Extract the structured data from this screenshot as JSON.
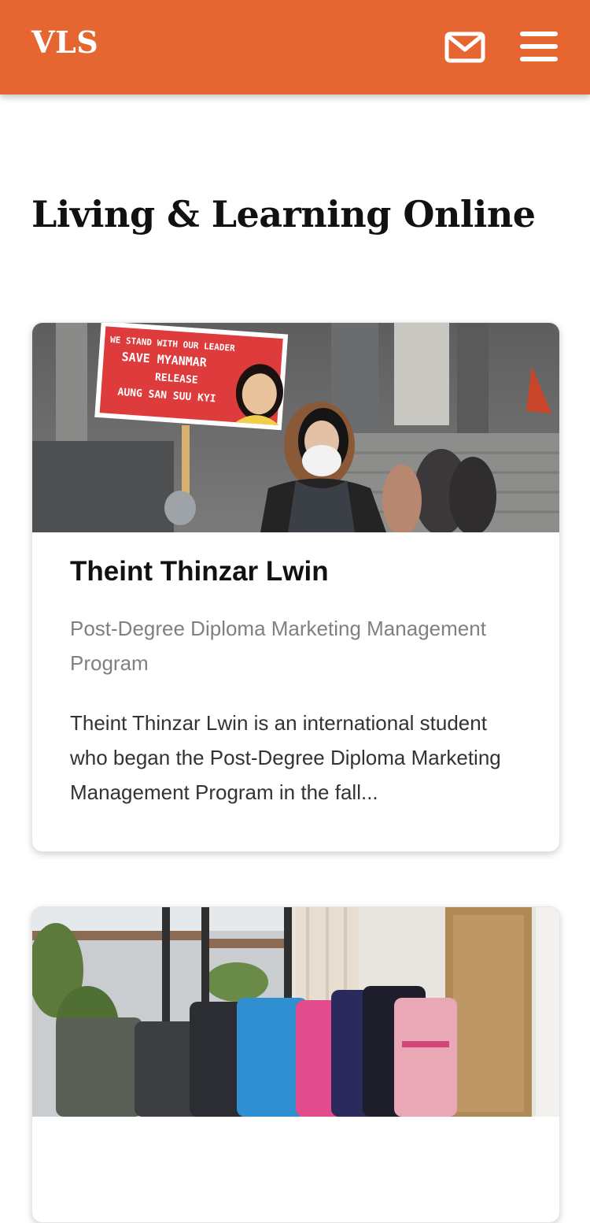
{
  "header": {
    "brand": "VLS",
    "mail_icon": "mail-icon",
    "menu_icon": "hamburger-menu-icon",
    "background_color": "#e56631"
  },
  "main": {
    "page_title": "Living & Learning Online",
    "cards": [
      {
        "title": "Theint Thinzar Lwin",
        "subtitle": "Post-Degree Diploma Marketing Management Program",
        "excerpt": "Theint Thinzar Lwin is an international student who began the Post-Degree Diploma Marketing Management Program in the fall...",
        "image": {
          "sign_line_1": "WE STAND WITH OUR LEADER",
          "sign_line_2": "SAVE MYANMAR",
          "sign_line_3": "RELEASE",
          "sign_line_4": "AUNG SAN SUU KYI"
        }
      },
      {
        "title": "",
        "subtitle": "",
        "excerpt": ""
      }
    ]
  }
}
